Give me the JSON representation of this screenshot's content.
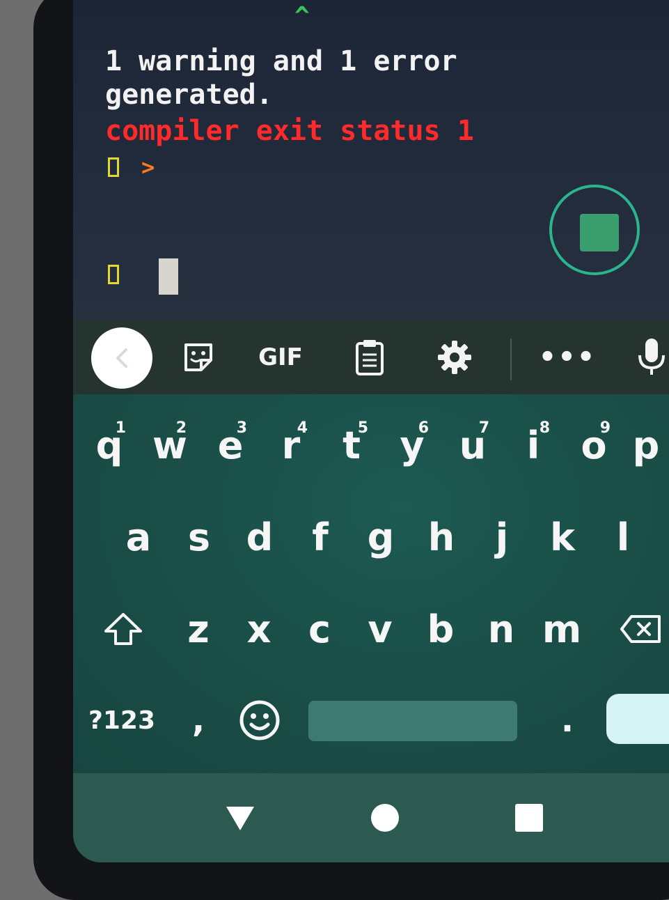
{
  "terminal": {
    "caret_mark": "^",
    "line1": "1 warning and 1 error",
    "line2": "generated.",
    "error_line": "compiler exit status 1",
    "prompt_arrow": ">",
    "colors": {
      "text": "#f2f2f2",
      "error": "#ff2a2a",
      "prompt_box": "#e4d830",
      "prompt_arrow": "#ff7a1c",
      "caret": "#39c45a"
    }
  },
  "stop_button": {
    "icon": "stop-square-icon",
    "accent": "#2bb58c"
  },
  "keyboard": {
    "toolbar": {
      "back_icon": "chevron-left-icon",
      "sticker_icon": "sticker-icon",
      "gif_label": "GIF",
      "clipboard_icon": "clipboard-icon",
      "settings_icon": "gear-icon",
      "more_label": "•••",
      "mic_icon": "microphone-icon"
    },
    "row1": [
      {
        "label": "q",
        "hint": "1"
      },
      {
        "label": "w",
        "hint": "2"
      },
      {
        "label": "e",
        "hint": "3"
      },
      {
        "label": "r",
        "hint": "4"
      },
      {
        "label": "t",
        "hint": "5"
      },
      {
        "label": "y",
        "hint": "6"
      },
      {
        "label": "u",
        "hint": "7"
      },
      {
        "label": "i",
        "hint": "8"
      },
      {
        "label": "o",
        "hint": "9"
      },
      {
        "label": "p",
        "hint": ""
      }
    ],
    "row2": [
      "a",
      "s",
      "d",
      "f",
      "g",
      "h",
      "j",
      "k",
      "l"
    ],
    "row3": [
      "z",
      "x",
      "c",
      "v",
      "b",
      "n",
      "m"
    ],
    "symbols_label": "?123",
    "comma_label": ",",
    "period_label": ".",
    "shift_icon": "shift-icon",
    "backspace_icon": "backspace-icon",
    "emoji_icon": "emoji-icon"
  },
  "navbar": {
    "back_icon": "nav-back-triangle-icon",
    "home_icon": "nav-home-circle-icon",
    "recents_icon": "nav-recents-square-icon"
  }
}
